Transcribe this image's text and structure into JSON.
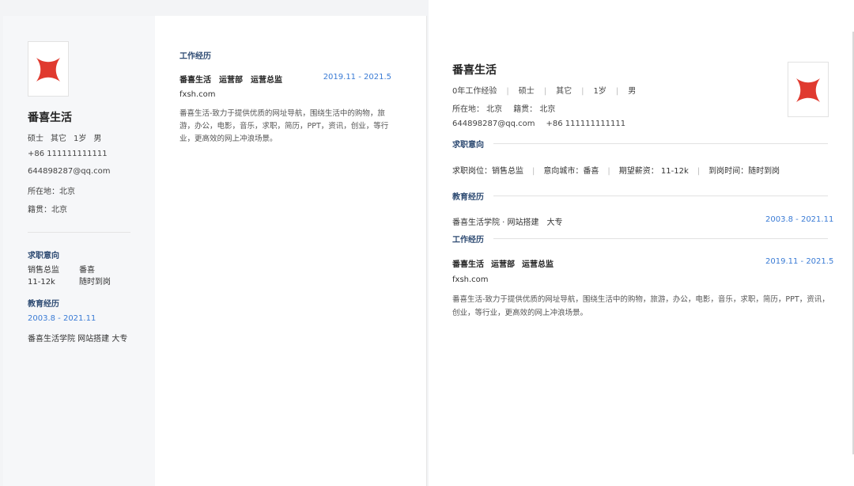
{
  "colors": {
    "accent": "#3a7bd5",
    "heading": "#2d4a72",
    "logo": "#e03a2f"
  },
  "profile": {
    "name": "番喜生活",
    "degree": "硕士",
    "other": "其它",
    "age": "1岁",
    "gender": "男",
    "experience": "0年工作经验",
    "phone": "+86 111111111111",
    "email": "644898287@qq.com",
    "location_label": "所在地：北京",
    "native_label": "籍贯：北京",
    "location_r": "所在地： 北京",
    "native_r": "籍贯： 北京",
    "photo_icon": "red-star-logo-icon"
  },
  "intent": {
    "heading": "求职意向",
    "position": "销售总监",
    "city": "番喜",
    "salary": "11-12k",
    "arrival": "随时到岗",
    "position_full": "求职岗位：销售总监",
    "city_full": "意向城市：番喜",
    "salary_full": "期望薪资： 11-12k",
    "arrival_full": "到岗时间：随时到岗"
  },
  "education": {
    "heading": "教育经历",
    "date": "2003.8 - 2021.11",
    "school_line": "番喜生活学院 网站搭建 大专",
    "school_line_r": "番喜生活学院 · 网站搭建　大专"
  },
  "work": {
    "heading": "工作经历",
    "company": "番喜生活",
    "department": "运营部",
    "role": "运营总监",
    "date": "2019.11 - 2021.5",
    "site": "fxsh.com",
    "desc": "番喜生活-致力于提供优质的网址导航，围绕生活中的购物，旅游，办公，电影，音乐，求职，简历，PPT，资讯，创业，等行业，更高效的网上冲浪场景。"
  }
}
